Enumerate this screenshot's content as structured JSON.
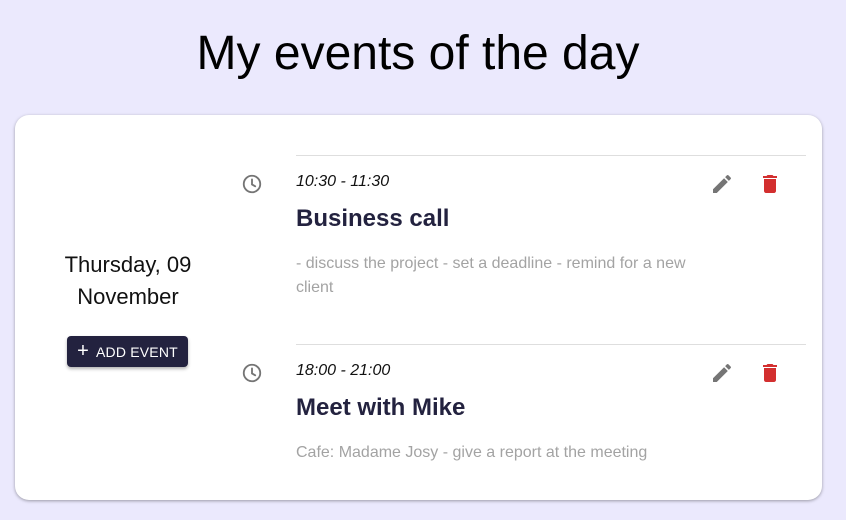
{
  "header": {
    "title": "My events of the day"
  },
  "day_panel": {
    "date_label": "Thursday, 09 November",
    "add_button": {
      "icon": "plus-icon",
      "label": "ADD EVENT"
    }
  },
  "events": [
    {
      "time": "10:30 - 11:30",
      "title": "Business call",
      "description": "- discuss the project - set a deadline - remind for a new client"
    },
    {
      "time": "18:00 - 21:00",
      "title": "Meet with Mike",
      "description": "Cafe: Madame Josy - give a report at the meeting"
    }
  ],
  "icons": {
    "clock": "clock-icon",
    "edit": "pencil-icon",
    "delete": "trash-icon"
  },
  "colors": {
    "background": "#ebe9fd",
    "card": "#ffffff",
    "primary": "#23223f",
    "delete": "#d32f2f",
    "edit": "#757575",
    "muted_text": "#a3a3a3"
  }
}
